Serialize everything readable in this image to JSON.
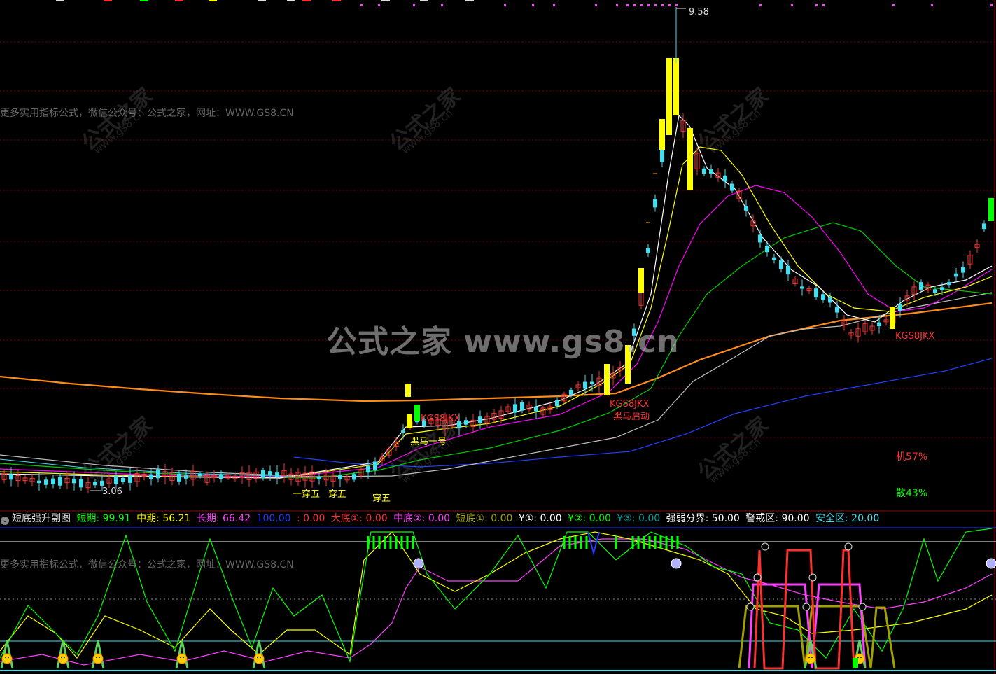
{
  "colors": {
    "bg": "#000000",
    "grid": "#7a0000",
    "up": "#ff3030",
    "down": "#40e0f0",
    "strong_up": "#ffff00",
    "strong_dn": "#00ff00",
    "ma5": "#ffffff",
    "ma10": "#ffff00",
    "ma20": "#ff00ff",
    "ma30": "#00cc00",
    "ma60": "#c0c0c0",
    "ma120": "#2040ff",
    "ma250": "#ff8c1a"
  },
  "main": {
    "high_label": "9.58",
    "low_label": "3.06",
    "markers": [
      {
        "text": "KGS8JKX",
        "color": "#ff3030"
      },
      {
        "text": "黑马一号",
        "color": "#ffff00"
      },
      {
        "text": "KGS8JKX",
        "color": "#ff3030"
      },
      {
        "text": "黑马启动",
        "color": "#ff3030"
      },
      {
        "text": "KGS8JKX",
        "color": "#ff3030"
      },
      {
        "text": "一穿五",
        "color": "#ffff00"
      },
      {
        "text": "穿五",
        "color": "#ffff00"
      },
      {
        "text": "穿五",
        "color": "#ffff00"
      }
    ],
    "ji_label": "机57%",
    "san_label": "散43%",
    "watermark": "公式之家 www.gs8.cn",
    "watermark_small": "公式之家",
    "watermark_url": "www.gs8.cn",
    "promo": "更多实用指标公式，微信公众号：公式之家，网址：WWW.GS8.CN"
  },
  "indicator": {
    "name": "短底强升副图",
    "items": [
      {
        "label": "短期: 99.91",
        "color": "#00ff00"
      },
      {
        "label": "中期: 56.21",
        "color": "#ffff00"
      },
      {
        "label": "长期: 66.42",
        "color": "#ff40ff"
      },
      {
        "label": "100.00",
        "color": "#2040ff"
      },
      {
        "label": ": 0.00",
        "color": "#ff3030"
      },
      {
        "label": "大底①: 0.00",
        "color": "#ff3030"
      },
      {
        "label": "中底②: 0.00",
        "color": "#ff40ff"
      },
      {
        "label": "短底①: 0.00",
        "color": "#a0a000"
      },
      {
        "label": "¥①: 0.00",
        "color": "#ffffff"
      },
      {
        "label": "¥②: 0.00",
        "color": "#00ff00"
      },
      {
        "label": "¥③: 0.00",
        "color": "#00a0a0"
      },
      {
        "label": "强弱分界: 50.00",
        "color": "#ffffff"
      },
      {
        "label": "警戒区: 90.00",
        "color": "#ffffff"
      },
      {
        "label": "安全区: 20.00",
        "color": "#40e0f0"
      }
    ],
    "promo": "更多实用指标公式，微信公众号：公式之家，网址：WWW.GS8.CN"
  },
  "chart_data": {
    "type": "candlestick",
    "price_high": 9.58,
    "price_low": 3.06,
    "moving_averages": [
      "ma5",
      "ma10",
      "ma20",
      "ma30",
      "ma60",
      "ma120",
      "ma250"
    ],
    "indicator_levels": {
      "strong_weak": 50,
      "warning": 90,
      "safe": 20
    },
    "indicator_values": {
      "short": 99.91,
      "mid": 56.21,
      "long": 66.42
    }
  }
}
